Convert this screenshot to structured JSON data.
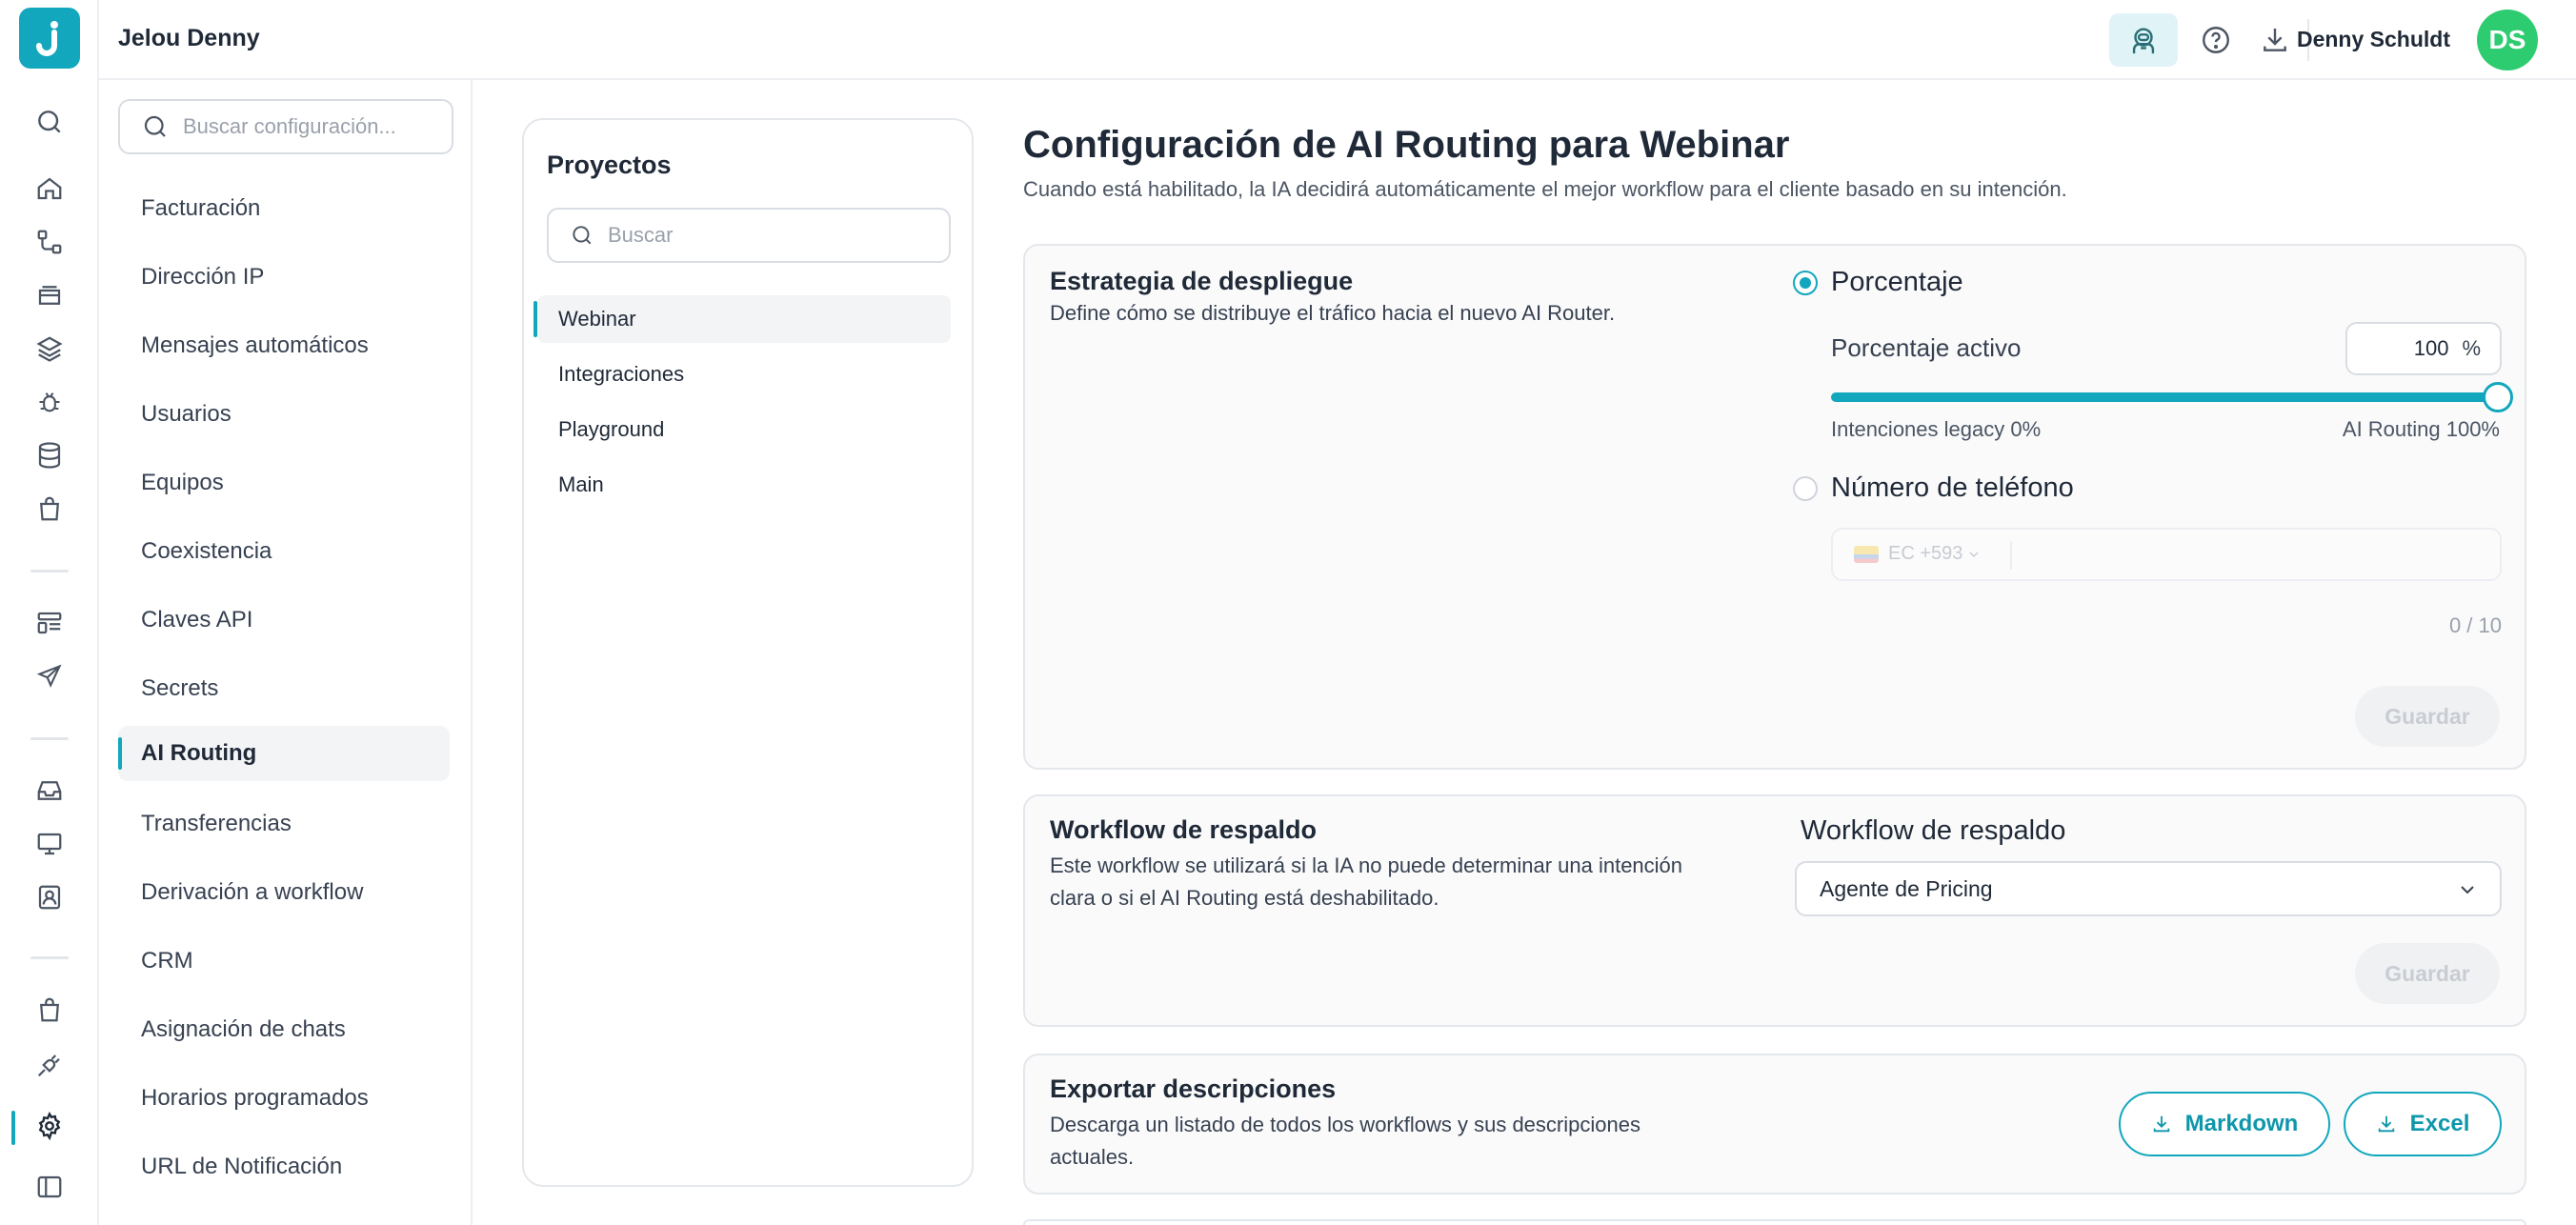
{
  "header": {
    "workspace": "Jelou Denny",
    "user_name": "Denny Schuldt",
    "user_initials": "DS"
  },
  "settings_sidebar": {
    "search_placeholder": "Buscar configuración...",
    "items": [
      {
        "label": "Facturación"
      },
      {
        "label": "Dirección IP"
      },
      {
        "label": "Mensajes automáticos"
      },
      {
        "label": "Usuarios"
      },
      {
        "label": "Equipos"
      },
      {
        "label": "Coexistencia"
      },
      {
        "label": "Claves API"
      },
      {
        "label": "Secrets"
      },
      {
        "label": "AI Routing",
        "active": true
      },
      {
        "label": "Transferencias"
      },
      {
        "label": "Derivación a workflow"
      },
      {
        "label": "CRM"
      },
      {
        "label": "Asignación de chats"
      },
      {
        "label": "Horarios programados"
      },
      {
        "label": "URL de Notificación"
      }
    ]
  },
  "projects": {
    "title": "Proyectos",
    "search_placeholder": "Buscar",
    "items": [
      {
        "label": "Webinar",
        "active": true
      },
      {
        "label": "Integraciones"
      },
      {
        "label": "Playground"
      },
      {
        "label": "Main"
      }
    ]
  },
  "main": {
    "title": "Configuración de AI Routing para Webinar",
    "subtitle": "Cuando está habilitado, la IA decidirá automáticamente el mejor workflow para el cliente basado en su intención.",
    "deployment": {
      "title": "Estrategia de despliegue",
      "description": "Define cómo se distribuye el tráfico hacia el nuevo AI Router.",
      "option_percentage": "Porcentaje",
      "active_percentage_label": "Porcentaje activo",
      "active_percentage_value": "100",
      "percent_symbol": "%",
      "slider_value": 100,
      "slider_left_caption": "Intenciones legacy 0%",
      "slider_right_caption": "AI Routing 100%",
      "option_phone": "Número de teléfono",
      "phone_country_code": "EC +593",
      "phone_counter": "0 / 10",
      "save_label": "Guardar"
    },
    "fallback": {
      "title": "Workflow de respaldo",
      "description_line1": "Este workflow se utilizará si la IA no puede determinar una intención",
      "description_line2": "clara o si el AI Routing está deshabilitado.",
      "select_label": "Workflow de respaldo",
      "selected_value": "Agente de Pricing",
      "save_label": "Guardar"
    },
    "export": {
      "title": "Exportar descripciones",
      "description_line1": "Descarga un listado de todos los workflows y sus descripciones",
      "description_line2": "actuales.",
      "markdown_label": "Markdown",
      "excel_label": "Excel"
    }
  },
  "colors": {
    "accent": "#12a7bd",
    "avatar": "#2ecc71"
  }
}
